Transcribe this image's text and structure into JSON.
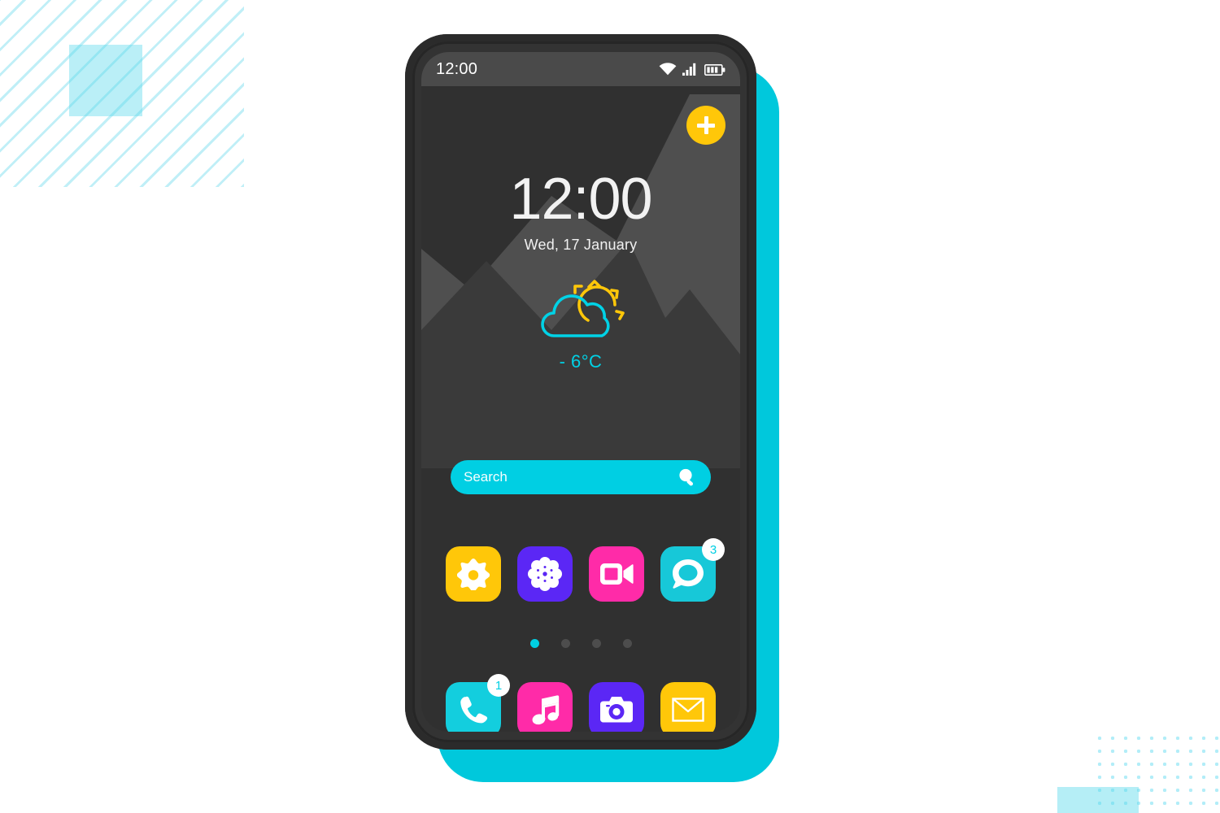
{
  "background": {
    "page_color": "#ffffff",
    "accent": "#00CFE3",
    "stripes_name": "diagonal-stripes-decoration",
    "square_name": "cyan-square-decoration",
    "dots_name": "dot-grid-decoration",
    "rect_name": "cyan-rectangle-decoration"
  },
  "phone": {
    "frame_color": "#333333",
    "shadow_color": "#00C8DC",
    "screen_color": "#303030"
  },
  "status_bar": {
    "time": "12:00",
    "icons": [
      "wifi-icon",
      "signal-icon",
      "battery-icon"
    ],
    "background": "#4a4a4a"
  },
  "fab": {
    "label": "+",
    "name": "add-button",
    "color": "#FFC709"
  },
  "clock": {
    "time": "12:00",
    "date": "Wed, 17 January"
  },
  "weather": {
    "temperature": "- 6°C",
    "icon": "partly-cloudy-icon",
    "cloud_color": "#00D2E6",
    "sun_color": "#FFC709"
  },
  "search": {
    "placeholder": "Search",
    "value": "",
    "icon": "search-icon",
    "color": "#00CFE3"
  },
  "apps_main": [
    {
      "name": "settings",
      "label": "Settings",
      "icon": "gear-icon",
      "color": "#FFC709",
      "badge": null
    },
    {
      "name": "gallery",
      "label": "Gallery",
      "icon": "flower-icon",
      "color": "#5B27F5",
      "badge": null
    },
    {
      "name": "video",
      "label": "Video",
      "icon": "video-camera-icon",
      "color": "#FF2BA8",
      "badge": null
    },
    {
      "name": "messages",
      "label": "Messages",
      "icon": "chat-bubble-icon",
      "color": "#17C8D8",
      "badge": "3"
    }
  ],
  "apps_dock": [
    {
      "name": "phone",
      "label": "Phone",
      "icon": "phone-handset-icon",
      "color": "#13CEDE",
      "badge": "1"
    },
    {
      "name": "music",
      "label": "Music",
      "icon": "music-note-icon",
      "color": "#FF2BA8",
      "badge": null
    },
    {
      "name": "camera",
      "label": "Camera",
      "icon": "camera-icon",
      "color": "#5B27F5",
      "badge": null
    },
    {
      "name": "mail",
      "label": "Mail",
      "icon": "envelope-icon",
      "color": "#FFC709",
      "badge": null
    }
  ],
  "page_dots": {
    "count": 4,
    "active_index": 0,
    "active_color": "#00CFE3",
    "inactive_color": "#4d4d4d"
  }
}
